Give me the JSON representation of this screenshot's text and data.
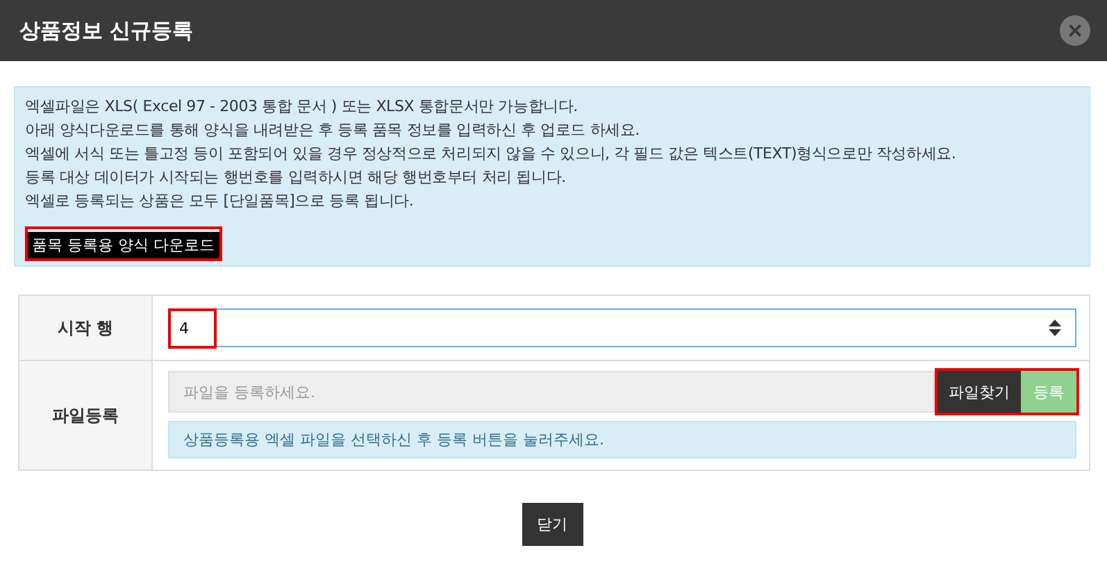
{
  "window": {
    "title": "상품정보 신규등록",
    "close_label": "×"
  },
  "notice": {
    "lines": [
      "엑셀파일은 XLS( Excel 97 - 2003 통합 문서 ) 또는 XLSX 통합문서만 가능합니다.",
      "아래 양식다운로드를 통해 양식을 내려받은 후 등록 품목 정보를 입력하신 후 업로드 하세요.",
      "엑셀에 서식 또는 틀고정 등이 포함되어 있을 경우 정상적으로 처리되지 않을 수 있으니, 각 필드 값은 텍스트(TEXT)형식으로만 작성하세요.",
      "등록 대상 데이터가 시작되는 행번호를 입력하시면 해당 행번호부터 처리 됩니다.",
      "엑셀로 등록되는 상품은 모두 [단일품목]으로 등록 됩니다."
    ],
    "download_button": {
      "label": "품목 등록용 양식 다운로드",
      "highlighted": true
    }
  },
  "form": {
    "start_row": {
      "label": "시작 행",
      "value": "4",
      "highlighted": true
    },
    "file": {
      "label": "파일등록",
      "placeholder": "파일을 등록하세요.",
      "buttons_highlighted": true,
      "browse_button": "파일찾기",
      "register_button": "등록",
      "hint": "상품등록용 엑셀 파일을 선택하신 후 등록 버튼을 눌러주세요."
    }
  },
  "buttons": [
    "닫기"
  ]
}
